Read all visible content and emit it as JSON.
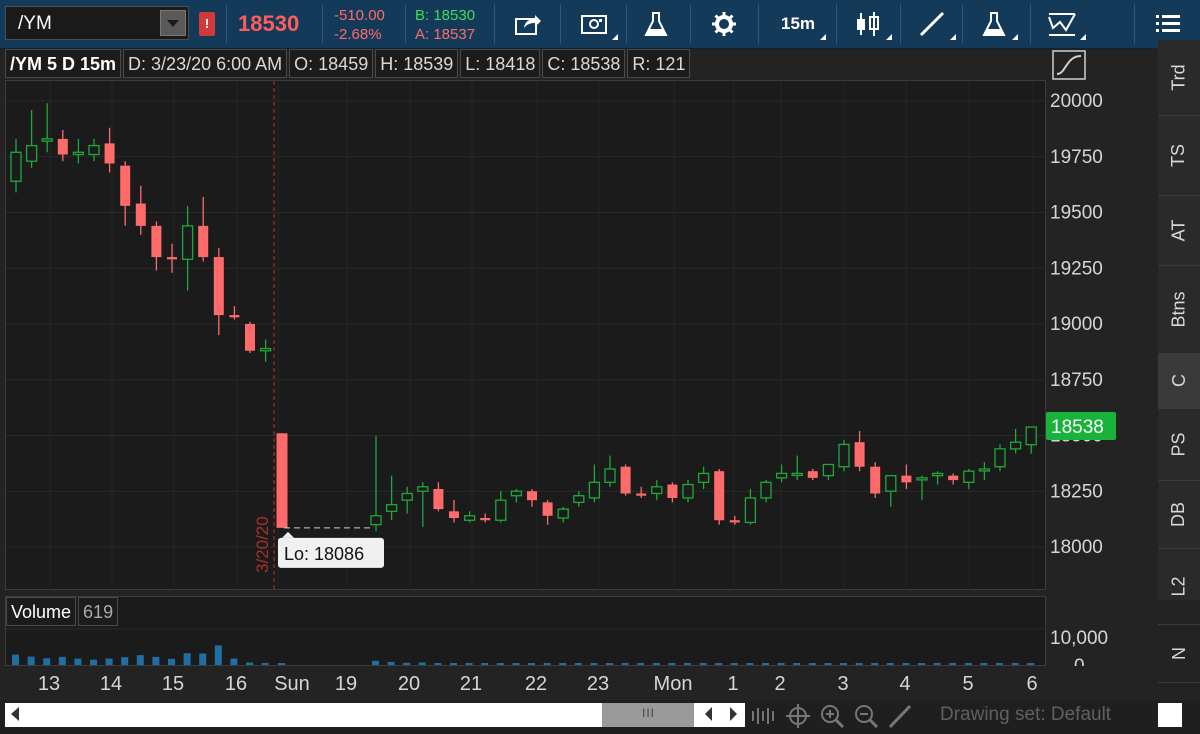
{
  "toolbar": {
    "symbol": "/YM",
    "alert_badge": "!",
    "last_price": "18530",
    "net_change": "-510.00",
    "pct_change": "-2.68%",
    "bid": "B: 18530",
    "ask": "A: 18537",
    "interval": "15m",
    "buttons": [
      "share-icon",
      "camera-icon",
      "flask-icon",
      "gear-icon",
      "interval",
      "candle-style-icon",
      "drawing-line-icon",
      "studies-flask-icon",
      "patterns-icon",
      "menu-icon"
    ]
  },
  "header": {
    "symbol_period": "/YM 5 D 15m",
    "date": "D: 3/23/20 6:00 AM",
    "open": "O: 18459",
    "high": "H: 18539",
    "low": "L: 18418",
    "close": "C: 18538",
    "range": "R: 121"
  },
  "price_axis": {
    "ticks": [
      "20000",
      "19750",
      "19500",
      "19250",
      "19000",
      "18750",
      "18500",
      "18250",
      "18000"
    ],
    "last_label": "18538",
    "last_color": "#19b23b"
  },
  "volume": {
    "label": "Volume",
    "value": "619",
    "axis_ticks": [
      "10,000",
      "0"
    ]
  },
  "annotations": {
    "low_label": "Lo: 18086",
    "session_date": "3/20/20"
  },
  "x_axis": [
    "13",
    "14",
    "15",
    "16",
    "Sun",
    "19",
    "20",
    "21",
    "22",
    "23",
    "Mon",
    "1",
    "2",
    "3",
    "4",
    "5",
    "6"
  ],
  "side_tabs": [
    "Trd",
    "TS",
    "AT",
    "Btns",
    "C",
    "PS",
    "DB",
    "L2",
    "N"
  ],
  "side_active": "C",
  "bottom": {
    "drawing_set": "Drawing set: Default",
    "thumb_label": "III"
  },
  "colors": {
    "up": "#1fa838",
    "down": "#ff6b6b",
    "volume_bar": "#1f6fa5",
    "toolbar_bg": "#143a5a"
  },
  "chart_data": {
    "type": "candlestick",
    "ylim": [
      17800,
      20070
    ],
    "candles": [
      {
        "o": 19640,
        "h": 19830,
        "l": 19590,
        "c": 19770
      },
      {
        "o": 19730,
        "h": 19960,
        "l": 19700,
        "c": 19800
      },
      {
        "o": 19820,
        "h": 19990,
        "l": 19770,
        "c": 19830
      },
      {
        "o": 19830,
        "h": 19870,
        "l": 19730,
        "c": 19760
      },
      {
        "o": 19760,
        "h": 19830,
        "l": 19720,
        "c": 19770
      },
      {
        "o": 19760,
        "h": 19830,
        "l": 19730,
        "c": 19800
      },
      {
        "o": 19810,
        "h": 19880,
        "l": 19680,
        "c": 19720
      },
      {
        "o": 19710,
        "h": 19730,
        "l": 19440,
        "c": 19530
      },
      {
        "o": 19540,
        "h": 19620,
        "l": 19400,
        "c": 19440
      },
      {
        "o": 19440,
        "h": 19460,
        "l": 19240,
        "c": 19300
      },
      {
        "o": 19300,
        "h": 19360,
        "l": 19230,
        "c": 19290
      },
      {
        "o": 19290,
        "h": 19530,
        "l": 19150,
        "c": 19440
      },
      {
        "o": 19440,
        "h": 19570,
        "l": 19280,
        "c": 19300
      },
      {
        "o": 19300,
        "h": 19340,
        "l": 18950,
        "c": 19040
      },
      {
        "o": 19040,
        "h": 19080,
        "l": 19020,
        "c": 19030
      },
      {
        "o": 19000,
        "h": 19010,
        "l": 18870,
        "c": 18880
      },
      {
        "o": 18880,
        "h": 18930,
        "l": 18830,
        "c": 18890
      },
      {
        "o": 18510,
        "h": 18510,
        "l": 18086,
        "c": 18086
      },
      {
        "o": 18100,
        "h": 18500,
        "l": 18070,
        "c": 18140
      },
      {
        "o": 18160,
        "h": 18320,
        "l": 18120,
        "c": 18190
      },
      {
        "o": 18210,
        "h": 18270,
        "l": 18150,
        "c": 18240
      },
      {
        "o": 18250,
        "h": 18290,
        "l": 18090,
        "c": 18270
      },
      {
        "o": 18260,
        "h": 18290,
        "l": 18160,
        "c": 18170
      },
      {
        "o": 18160,
        "h": 18210,
        "l": 18110,
        "c": 18130
      },
      {
        "o": 18120,
        "h": 18160,
        "l": 18110,
        "c": 18140
      },
      {
        "o": 18130,
        "h": 18150,
        "l": 18110,
        "c": 18120
      },
      {
        "o": 18120,
        "h": 18250,
        "l": 18110,
        "c": 18210
      },
      {
        "o": 18230,
        "h": 18260,
        "l": 18200,
        "c": 18250
      },
      {
        "o": 18250,
        "h": 18260,
        "l": 18180,
        "c": 18210
      },
      {
        "o": 18200,
        "h": 18210,
        "l": 18100,
        "c": 18140
      },
      {
        "o": 18130,
        "h": 18180,
        "l": 18110,
        "c": 18170
      },
      {
        "o": 18200,
        "h": 18250,
        "l": 18180,
        "c": 18230
      },
      {
        "o": 18220,
        "h": 18370,
        "l": 18200,
        "c": 18290
      },
      {
        "o": 18290,
        "h": 18410,
        "l": 18270,
        "c": 18350
      },
      {
        "o": 18360,
        "h": 18370,
        "l": 18230,
        "c": 18240
      },
      {
        "o": 18240,
        "h": 18270,
        "l": 18220,
        "c": 18230
      },
      {
        "o": 18240,
        "h": 18300,
        "l": 18210,
        "c": 18270
      },
      {
        "o": 18280,
        "h": 18290,
        "l": 18200,
        "c": 18220
      },
      {
        "o": 18220,
        "h": 18300,
        "l": 18200,
        "c": 18280
      },
      {
        "o": 18290,
        "h": 18360,
        "l": 18260,
        "c": 18330
      },
      {
        "o": 18340,
        "h": 18350,
        "l": 18100,
        "c": 18120
      },
      {
        "o": 18120,
        "h": 18140,
        "l": 18100,
        "c": 18110
      },
      {
        "o": 18110,
        "h": 18260,
        "l": 18100,
        "c": 18220
      },
      {
        "o": 18220,
        "h": 18300,
        "l": 18200,
        "c": 18290
      },
      {
        "o": 18310,
        "h": 18370,
        "l": 18290,
        "c": 18330
      },
      {
        "o": 18330,
        "h": 18410,
        "l": 18300,
        "c": 18330
      },
      {
        "o": 18340,
        "h": 18350,
        "l": 18300,
        "c": 18310
      },
      {
        "o": 18320,
        "h": 18370,
        "l": 18300,
        "c": 18370
      },
      {
        "o": 18360,
        "h": 18480,
        "l": 18340,
        "c": 18460
      },
      {
        "o": 18470,
        "h": 18520,
        "l": 18340,
        "c": 18360
      },
      {
        "o": 18360,
        "h": 18380,
        "l": 18220,
        "c": 18240
      },
      {
        "o": 18250,
        "h": 18320,
        "l": 18180,
        "c": 18320
      },
      {
        "o": 18320,
        "h": 18370,
        "l": 18260,
        "c": 18290
      },
      {
        "o": 18310,
        "h": 18320,
        "l": 18210,
        "c": 18310
      },
      {
        "o": 18320,
        "h": 18340,
        "l": 18280,
        "c": 18330
      },
      {
        "o": 18320,
        "h": 18330,
        "l": 18280,
        "c": 18300
      },
      {
        "o": 18290,
        "h": 18350,
        "l": 18260,
        "c": 18340
      },
      {
        "o": 18350,
        "h": 18380,
        "l": 18300,
        "c": 18350
      },
      {
        "o": 18360,
        "h": 18460,
        "l": 18340,
        "c": 18440
      },
      {
        "o": 18440,
        "h": 18530,
        "l": 18420,
        "c": 18470
      },
      {
        "o": 18459,
        "h": 18539,
        "l": 18418,
        "c": 18538
      }
    ],
    "volumes": [
      3700,
      3000,
      2400,
      2900,
      2300,
      1900,
      2300,
      2800,
      3500,
      2900,
      2200,
      4200,
      4100,
      7000,
      2300,
      900,
      500,
      600,
      1500,
      1100,
      800,
      900,
      700,
      600,
      500,
      500,
      500,
      500,
      500,
      500,
      500,
      500,
      500,
      500,
      500,
      500,
      500,
      500,
      500,
      500,
      500,
      500,
      500,
      500,
      500,
      500,
      500,
      500,
      500,
      500,
      500,
      500,
      500,
      500,
      500,
      500,
      500,
      500,
      500,
      500,
      500
    ]
  }
}
